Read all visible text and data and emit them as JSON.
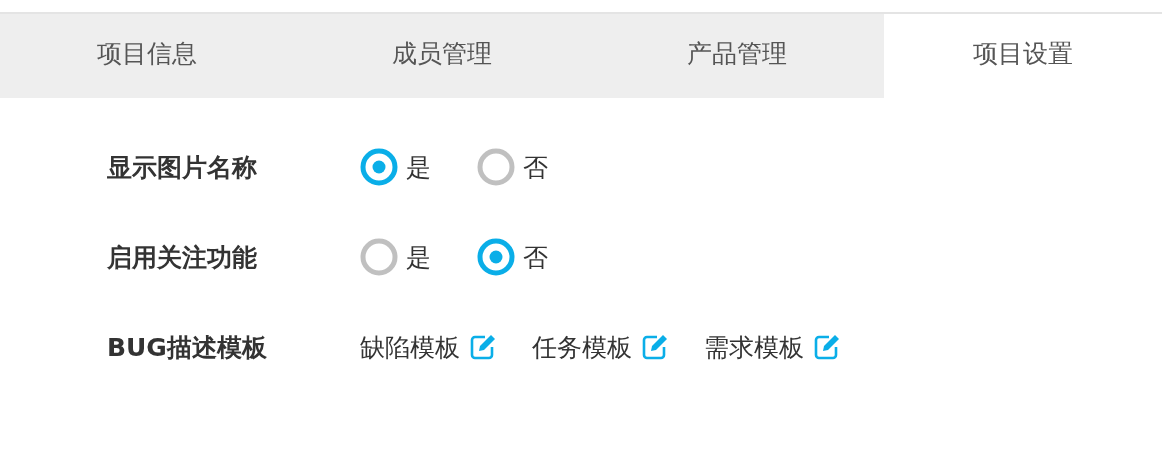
{
  "tabs": [
    {
      "label": "项目信息",
      "selected": false
    },
    {
      "label": "成员管理",
      "selected": false
    },
    {
      "label": "产品管理",
      "selected": false
    },
    {
      "label": "项目设置",
      "selected": true
    }
  ],
  "settings": [
    {
      "kind": "radio",
      "label": "显示图片名称",
      "options": [
        {
          "label": "是",
          "selected": true
        },
        {
          "label": "否",
          "selected": false
        }
      ]
    },
    {
      "kind": "radio",
      "label": "启用关注功能",
      "options": [
        {
          "label": "是",
          "selected": false
        },
        {
          "label": "否",
          "selected": true
        }
      ]
    },
    {
      "kind": "links",
      "label": "BUG描述模板",
      "links": [
        "缺陷模板",
        "任务模板",
        "需求模板"
      ]
    }
  ]
}
